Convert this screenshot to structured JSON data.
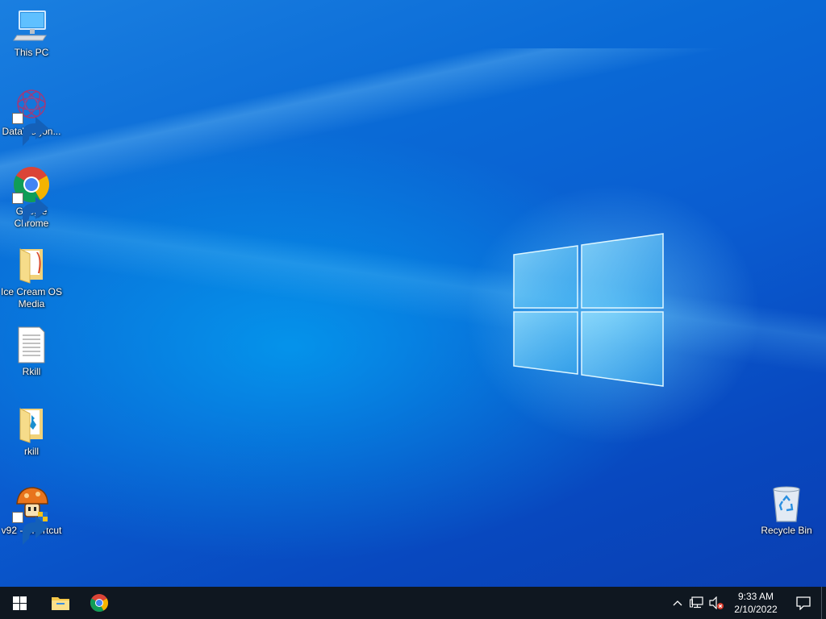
{
  "desktop": {
    "icons": [
      {
        "label": "This PC",
        "icon": "this-pc-icon"
      },
      {
        "label": "DataWagon...",
        "icon": "datawagon-icon"
      },
      {
        "label": "Google Chrome",
        "icon": "chrome-icon"
      },
      {
        "label": "Ice  Cream OS Media",
        "icon": "folder-icon"
      },
      {
        "label": "Rkill",
        "icon": "text-document-icon"
      },
      {
        "label": "rkill",
        "icon": "folder-icon"
      },
      {
        "label": "v92 - Shortcut",
        "icon": "mushroom-icon"
      }
    ],
    "recycle_bin": {
      "label": "Recycle Bin",
      "icon": "recycle-bin-icon"
    }
  },
  "taskbar": {
    "pinned": [
      {
        "name": "start",
        "icon": "windows-start-icon"
      },
      {
        "name": "file-explorer",
        "icon": "file-explorer-icon"
      },
      {
        "name": "google-chrome",
        "icon": "chrome-icon"
      }
    ],
    "tray": {
      "icons": [
        "chevron-up-icon",
        "network-icon",
        "volume-muted-icon"
      ],
      "time": "9:33 AM",
      "date": "2/10/2022",
      "notification_icon": "notification-icon"
    }
  },
  "colors": {
    "taskbar": "#0f1720",
    "desktop_accent": "#0a5cd0"
  }
}
